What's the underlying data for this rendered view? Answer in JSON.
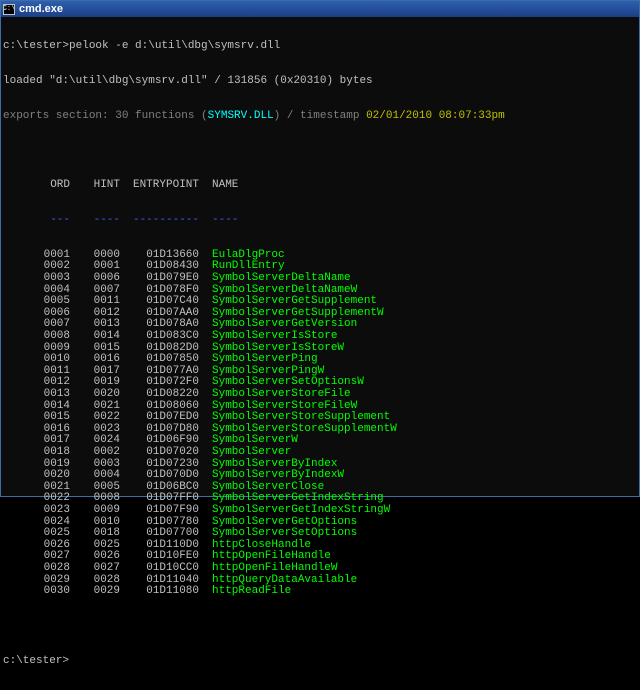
{
  "window": {
    "title": "cmd.exe",
    "icon": "cmd-icon"
  },
  "console": {
    "line1": "c:\\tester>pelook -e d:\\util\\dbg\\symsrv.dll",
    "line2": "loaded \"d:\\util\\dbg\\symsrv.dll\" / 131856 (0x20310) bytes",
    "line3_prefix": "exports section: 30 functions (",
    "line3_dll": "SYMSRV.DLL",
    "line3_mid": ") / timestamp ",
    "line3_ts": "02/01/2010 08:07:33pm",
    "headers": {
      "ord": "ORD",
      "hint": "HINT",
      "entrypoint": "ENTRYPOINT",
      "name": "NAME"
    },
    "dashes": {
      "ord": "---",
      "hint": "----",
      "entrypoint": "----------",
      "name": "----"
    },
    "prompt": "c:\\tester>"
  },
  "exports": [
    {
      "ord": "0001",
      "hint": "0000",
      "ep": "01D13660",
      "name": "EulaDlgProc"
    },
    {
      "ord": "0002",
      "hint": "0001",
      "ep": "01D08430",
      "name": "RunDllEntry"
    },
    {
      "ord": "0003",
      "hint": "0006",
      "ep": "01D079E0",
      "name": "SymbolServerDeltaName"
    },
    {
      "ord": "0004",
      "hint": "0007",
      "ep": "01D078F0",
      "name": "SymbolServerDeltaNameW"
    },
    {
      "ord": "0005",
      "hint": "0011",
      "ep": "01D07C40",
      "name": "SymbolServerGetSupplement"
    },
    {
      "ord": "0006",
      "hint": "0012",
      "ep": "01D07AA0",
      "name": "SymbolServerGetSupplementW"
    },
    {
      "ord": "0007",
      "hint": "0013",
      "ep": "01D078A0",
      "name": "SymbolServerGetVersion"
    },
    {
      "ord": "0008",
      "hint": "0014",
      "ep": "01D083C0",
      "name": "SymbolServerIsStore"
    },
    {
      "ord": "0009",
      "hint": "0015",
      "ep": "01D082D0",
      "name": "SymbolServerIsStoreW"
    },
    {
      "ord": "0010",
      "hint": "0016",
      "ep": "01D07850",
      "name": "SymbolServerPing"
    },
    {
      "ord": "0011",
      "hint": "0017",
      "ep": "01D077A0",
      "name": "SymbolServerPingW"
    },
    {
      "ord": "0012",
      "hint": "0019",
      "ep": "01D072F0",
      "name": "SymbolServerSetOptionsW"
    },
    {
      "ord": "0013",
      "hint": "0020",
      "ep": "01D08220",
      "name": "SymbolServerStoreFile"
    },
    {
      "ord": "0014",
      "hint": "0021",
      "ep": "01D08060",
      "name": "SymbolServerStoreFileW"
    },
    {
      "ord": "0015",
      "hint": "0022",
      "ep": "01D07ED0",
      "name": "SymbolServerStoreSupplement"
    },
    {
      "ord": "0016",
      "hint": "0023",
      "ep": "01D07D80",
      "name": "SymbolServerStoreSupplementW"
    },
    {
      "ord": "0017",
      "hint": "0024",
      "ep": "01D06F90",
      "name": "SymbolServerW"
    },
    {
      "ord": "0018",
      "hint": "0002",
      "ep": "01D07020",
      "name": "SymbolServer"
    },
    {
      "ord": "0019",
      "hint": "0003",
      "ep": "01D07230",
      "name": "SymbolServerByIndex"
    },
    {
      "ord": "0020",
      "hint": "0004",
      "ep": "01D070D0",
      "name": "SymbolServerByIndexW"
    },
    {
      "ord": "0021",
      "hint": "0005",
      "ep": "01D06BC0",
      "name": "SymbolServerClose"
    },
    {
      "ord": "0022",
      "hint": "0008",
      "ep": "01D07FF0",
      "name": "SymbolServerGetIndexString"
    },
    {
      "ord": "0023",
      "hint": "0009",
      "ep": "01D07F90",
      "name": "SymbolServerGetIndexStringW"
    },
    {
      "ord": "0024",
      "hint": "0010",
      "ep": "01D07780",
      "name": "SymbolServerGetOptions"
    },
    {
      "ord": "0025",
      "hint": "0018",
      "ep": "01D07700",
      "name": "SymbolServerSetOptions"
    },
    {
      "ord": "0026",
      "hint": "0025",
      "ep": "01D110D0",
      "name": "httpCloseHandle"
    },
    {
      "ord": "0027",
      "hint": "0026",
      "ep": "01D10FE0",
      "name": "httpOpenFileHandle"
    },
    {
      "ord": "0028",
      "hint": "0027",
      "ep": "01D10CC0",
      "name": "httpOpenFileHandleW"
    },
    {
      "ord": "0029",
      "hint": "0028",
      "ep": "01D11040",
      "name": "httpQueryDataAvailable"
    },
    {
      "ord": "0030",
      "hint": "0029",
      "ep": "01D11080",
      "name": "httpReadFile"
    }
  ]
}
